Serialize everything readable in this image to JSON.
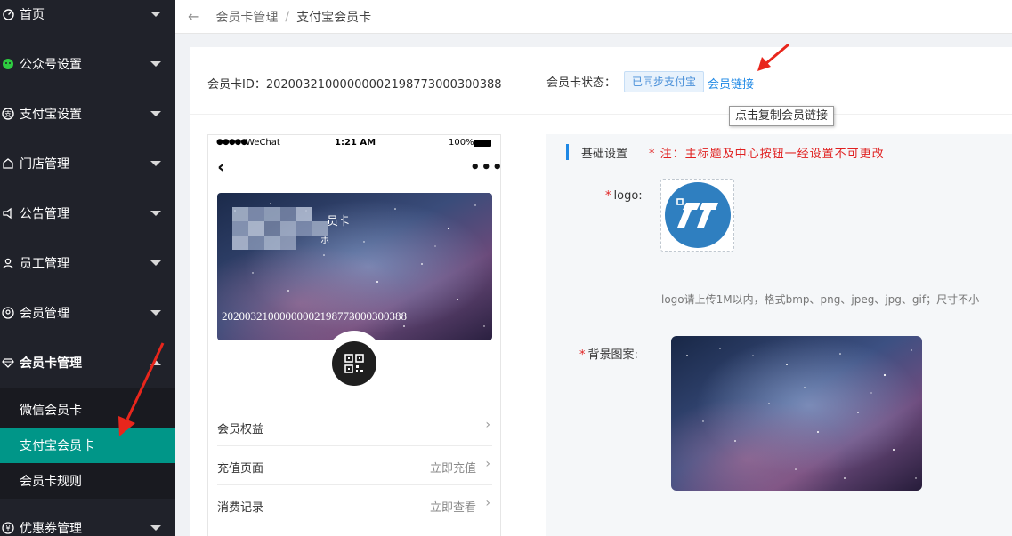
{
  "sidebar": {
    "items": [
      {
        "label": "首页",
        "icon": "dashboard-icon"
      },
      {
        "label": "公众号设置",
        "icon": "wechat-icon"
      },
      {
        "label": "支付宝设置",
        "icon": "alipay-icon"
      },
      {
        "label": "门店管理",
        "icon": "store-icon"
      },
      {
        "label": "公告管理",
        "icon": "announcement-icon"
      },
      {
        "label": "员工管理",
        "icon": "staff-icon"
      },
      {
        "label": "会员管理",
        "icon": "member-icon"
      },
      {
        "label": "会员卡管理",
        "icon": "diamond-icon"
      },
      {
        "label": "优惠券管理",
        "icon": "coupon-icon"
      }
    ],
    "submenu": [
      {
        "label": "微信会员卡"
      },
      {
        "label": "支付宝会员卡"
      },
      {
        "label": "会员卡规则"
      }
    ],
    "active_submenu": "支付宝会员卡"
  },
  "breadcrumb": {
    "items": [
      "会员卡管理",
      "支付宝会员卡"
    ],
    "separator": "/"
  },
  "card_info": {
    "id_label": "会员卡ID：20200321000000002198773000300388",
    "status_label": "会员卡状态：",
    "status_badge": "已同步支付宝",
    "member_link": "会员链接",
    "tooltip": "点击复制会员链接"
  },
  "phone": {
    "carrier": "WeChat",
    "time": "1:21 AM",
    "battery": "100%",
    "card_title_partial": "员卡",
    "card_sub_partial": "ホ",
    "card_id": "20200321000000002198773000300388",
    "rows": [
      {
        "label": "会员权益",
        "action": ""
      },
      {
        "label": "充值页面",
        "action": "立即充值"
      },
      {
        "label": "消费记录",
        "action": "立即查看"
      }
    ]
  },
  "settings": {
    "section_title": "基础设置",
    "note": "*  注：主标题及中心按钮一经设置不可更改",
    "logo_label": "logo:",
    "logo_hint": "logo请上传1M以内，格式bmp、png、jpeg、jpg、gif；尺寸不小",
    "bg_label": "背景图案:",
    "required_mark": "*"
  },
  "colors": {
    "sidebar_bg": "#20222a",
    "active_item": "#009688",
    "link": "#1e88e5",
    "note_red": "#e02020",
    "annotation_red": "#e8261c"
  }
}
